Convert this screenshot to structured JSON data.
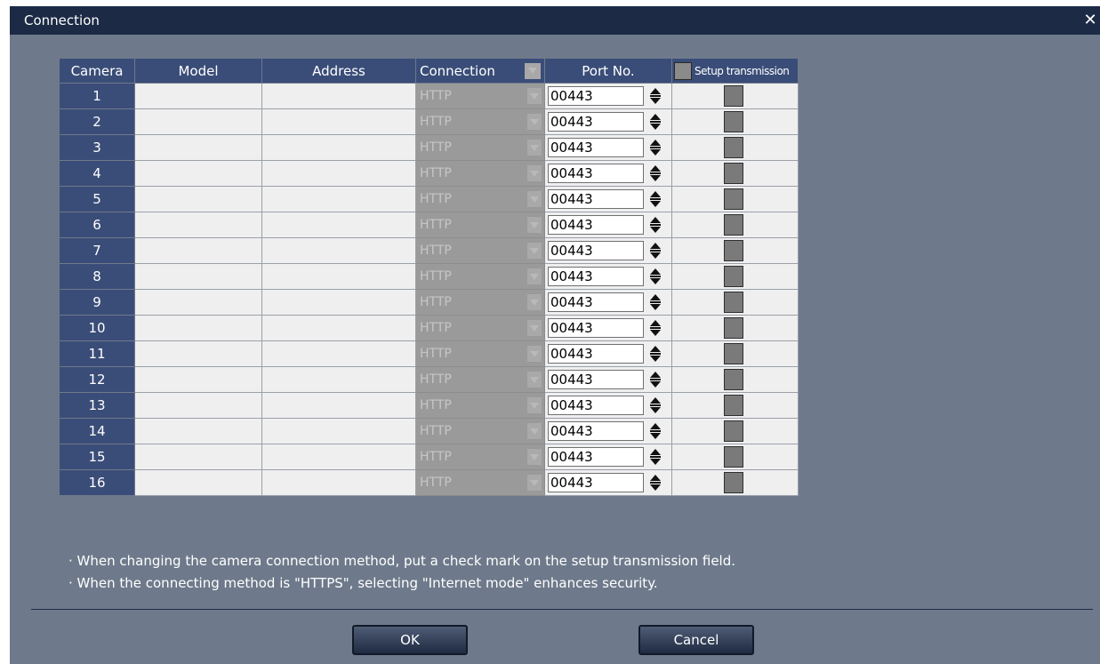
{
  "window": {
    "title": "Connection",
    "close_glyph": "✕"
  },
  "table": {
    "headers": {
      "camera": "Camera",
      "model": "Model",
      "address": "Address",
      "connection": "Connection",
      "port": "Port No.",
      "setup": "Setup transmission"
    },
    "rows": [
      {
        "camera": "1",
        "model": "",
        "address": "",
        "connection": "HTTP",
        "port": "00443",
        "setup_checked": false
      },
      {
        "camera": "2",
        "model": "",
        "address": "",
        "connection": "HTTP",
        "port": "00443",
        "setup_checked": false
      },
      {
        "camera": "3",
        "model": "",
        "address": "",
        "connection": "HTTP",
        "port": "00443",
        "setup_checked": false
      },
      {
        "camera": "4",
        "model": "",
        "address": "",
        "connection": "HTTP",
        "port": "00443",
        "setup_checked": false
      },
      {
        "camera": "5",
        "model": "",
        "address": "",
        "connection": "HTTP",
        "port": "00443",
        "setup_checked": false
      },
      {
        "camera": "6",
        "model": "",
        "address": "",
        "connection": "HTTP",
        "port": "00443",
        "setup_checked": false
      },
      {
        "camera": "7",
        "model": "",
        "address": "",
        "connection": "HTTP",
        "port": "00443",
        "setup_checked": false
      },
      {
        "camera": "8",
        "model": "",
        "address": "",
        "connection": "HTTP",
        "port": "00443",
        "setup_checked": false
      },
      {
        "camera": "9",
        "model": "",
        "address": "",
        "connection": "HTTP",
        "port": "00443",
        "setup_checked": false
      },
      {
        "camera": "10",
        "model": "",
        "address": "",
        "connection": "HTTP",
        "port": "00443",
        "setup_checked": false
      },
      {
        "camera": "11",
        "model": "",
        "address": "",
        "connection": "HTTP",
        "port": "00443",
        "setup_checked": false
      },
      {
        "camera": "12",
        "model": "",
        "address": "",
        "connection": "HTTP",
        "port": "00443",
        "setup_checked": false
      },
      {
        "camera": "13",
        "model": "",
        "address": "",
        "connection": "HTTP",
        "port": "00443",
        "setup_checked": false
      },
      {
        "camera": "14",
        "model": "",
        "address": "",
        "connection": "HTTP",
        "port": "00443",
        "setup_checked": false
      },
      {
        "camera": "15",
        "model": "",
        "address": "",
        "connection": "HTTP",
        "port": "00443",
        "setup_checked": false
      },
      {
        "camera": "16",
        "model": "",
        "address": "",
        "connection": "HTTP",
        "port": "00443",
        "setup_checked": false
      }
    ]
  },
  "notes": [
    "· When changing the camera connection method, put a check mark on the setup transmission field.",
    "· When the connecting method is \"HTTPS\", selecting \"Internet mode\"  enhances security."
  ],
  "buttons": {
    "ok": "OK",
    "cancel": "Cancel"
  },
  "colors": {
    "dialog_bg": "#6e7a8b",
    "titlebar_bg": "#1c2a45",
    "header_bg": "#3a4d78",
    "cell_bg": "#efefef",
    "disabled_bg": "#9a9a9a"
  }
}
